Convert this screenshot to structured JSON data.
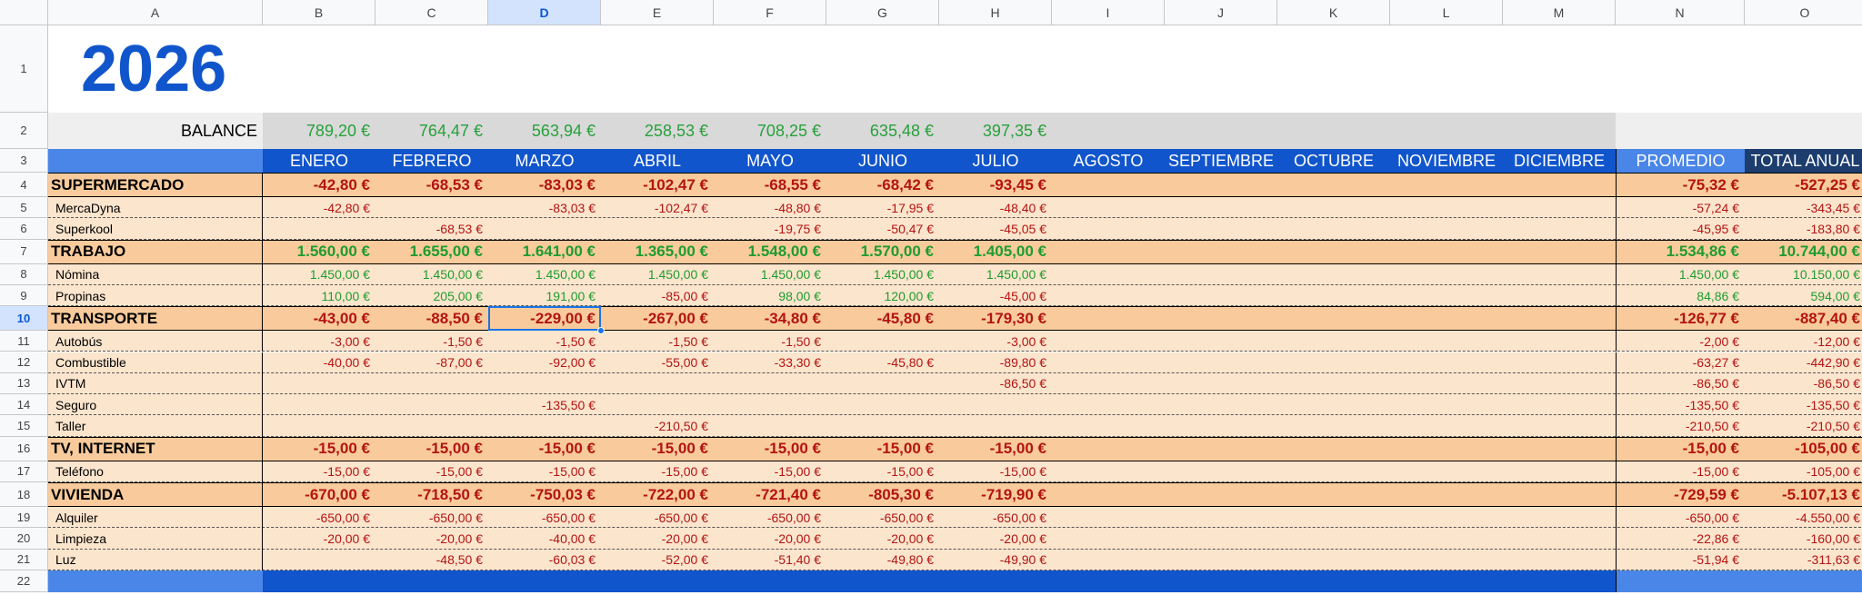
{
  "columns": [
    "A",
    "B",
    "C",
    "D",
    "E",
    "F",
    "G",
    "H",
    "I",
    "J",
    "K",
    "L",
    "M",
    "N",
    "O"
  ],
  "selected_column": "D",
  "selected_row": 10,
  "row_numbers": [
    1,
    2,
    3,
    4,
    5,
    6,
    7,
    8,
    9,
    10,
    11,
    12,
    13,
    14,
    15,
    16,
    17,
    18,
    19,
    20,
    21,
    22
  ],
  "title": "2026",
  "balance": {
    "label": "BALANCE",
    "values": [
      "789,20 €",
      "764,47 €",
      "563,94 €",
      "258,53 €",
      "708,25 €",
      "635,48 €",
      "397,35 €",
      "",
      "",
      "",
      "",
      "",
      "",
      ""
    ]
  },
  "months": [
    "ENERO",
    "FEBRERO",
    "MARZO",
    "ABRIL",
    "MAYO",
    "JUNIO",
    "JULIO",
    "AGOSTO",
    "SEPTIEMBRE",
    "OCTUBRE",
    "NOVIEMBRE",
    "DICIEMBRE",
    "PROMEDIO",
    "TOTAL ANUAL"
  ],
  "rows": [
    {
      "row": 4,
      "type": "category",
      "label": "SUPERMERCADO",
      "sign": "neg",
      "values": [
        "-42,80 €",
        "-68,53 €",
        "-83,03 €",
        "-102,47 €",
        "-68,55 €",
        "-68,42 €",
        "-93,45 €",
        "",
        "",
        "",
        "",
        "",
        "-75,32 €",
        "-527,25 €"
      ]
    },
    {
      "row": 5,
      "type": "item",
      "label": "MercaDyna",
      "sign": "neg",
      "values": [
        "-42,80 €",
        "",
        "-83,03 €",
        "-102,47 €",
        "-48,80 €",
        "-17,95 €",
        "-48,40 €",
        "",
        "",
        "",
        "",
        "",
        "-57,24 €",
        "-343,45 €"
      ]
    },
    {
      "row": 6,
      "type": "item",
      "label": "Superkool",
      "sign": "neg",
      "values": [
        "",
        "-68,53 €",
        "",
        "",
        "-19,75 €",
        "-50,47 €",
        "-45,05 €",
        "",
        "",
        "",
        "",
        "",
        "-45,95 €",
        "-183,80 €"
      ]
    },
    {
      "row": 7,
      "type": "category",
      "label": "TRABAJO",
      "sign": "pos",
      "values": [
        "1.560,00 €",
        "1.655,00 €",
        "1.641,00 €",
        "1.365,00 €",
        "1.548,00 €",
        "1.570,00 €",
        "1.405,00 €",
        "",
        "",
        "",
        "",
        "",
        "1.534,86 €",
        "10.744,00 €"
      ]
    },
    {
      "row": 8,
      "type": "item",
      "label": "Nómina",
      "sign": "pos",
      "values": [
        "1.450,00 €",
        "1.450,00 €",
        "1.450,00 €",
        "1.450,00 €",
        "1.450,00 €",
        "1.450,00 €",
        "1.450,00 €",
        "",
        "",
        "",
        "",
        "",
        "1.450,00 €",
        "10.150,00 €"
      ]
    },
    {
      "row": 9,
      "type": "item",
      "label": "Propinas",
      "sign": "mixed",
      "values": [
        "110,00 €",
        "205,00 €",
        "191,00 €",
        "-85,00 €",
        "98,00 €",
        "120,00 €",
        "-45,00 €",
        "",
        "",
        "",
        "",
        "",
        "84,86 €",
        "594,00 €"
      ]
    },
    {
      "row": 10,
      "type": "category",
      "label": "TRANSPORTE",
      "sign": "neg",
      "values": [
        "-43,00 €",
        "-88,50 €",
        "-229,00 €",
        "-267,00 €",
        "-34,80 €",
        "-45,80 €",
        "-179,30 €",
        "",
        "",
        "",
        "",
        "",
        "-126,77 €",
        "-887,40 €"
      ]
    },
    {
      "row": 11,
      "type": "item",
      "label": "Autobús",
      "sign": "neg",
      "values": [
        "-3,00 €",
        "-1,50 €",
        "-1,50 €",
        "-1,50 €",
        "-1,50 €",
        "",
        "-3,00 €",
        "",
        "",
        "",
        "",
        "",
        "-2,00 €",
        "-12,00 €"
      ]
    },
    {
      "row": 12,
      "type": "item",
      "label": "Combustible",
      "sign": "neg",
      "values": [
        "-40,00 €",
        "-87,00 €",
        "-92,00 €",
        "-55,00 €",
        "-33,30 €",
        "-45,80 €",
        "-89,80 €",
        "",
        "",
        "",
        "",
        "",
        "-63,27 €",
        "-442,90 €"
      ]
    },
    {
      "row": 13,
      "type": "item",
      "label": "IVTM",
      "sign": "neg",
      "values": [
        "",
        "",
        "",
        "",
        "",
        "",
        "-86,50 €",
        "",
        "",
        "",
        "",
        "",
        "-86,50 €",
        "-86,50 €"
      ]
    },
    {
      "row": 14,
      "type": "item",
      "label": "Seguro",
      "sign": "neg",
      "values": [
        "",
        "",
        "-135,50 €",
        "",
        "",
        "",
        "",
        "",
        "",
        "",
        "",
        "",
        "-135,50 €",
        "-135,50 €"
      ]
    },
    {
      "row": 15,
      "type": "item",
      "label": "Taller",
      "sign": "neg",
      "values": [
        "",
        "",
        "",
        "-210,50 €",
        "",
        "",
        "",
        "",
        "",
        "",
        "",
        "",
        "-210,50 €",
        "-210,50 €"
      ]
    },
    {
      "row": 16,
      "type": "category",
      "label": "TV, INTERNET",
      "sign": "neg",
      "values": [
        "-15,00 €",
        "-15,00 €",
        "-15,00 €",
        "-15,00 €",
        "-15,00 €",
        "-15,00 €",
        "-15,00 €",
        "",
        "",
        "",
        "",
        "",
        "-15,00 €",
        "-105,00 €"
      ]
    },
    {
      "row": 17,
      "type": "item",
      "label": "Teléfono",
      "sign": "neg",
      "values": [
        "-15,00 €",
        "-15,00 €",
        "-15,00 €",
        "-15,00 €",
        "-15,00 €",
        "-15,00 €",
        "-15,00 €",
        "",
        "",
        "",
        "",
        "",
        "-15,00 €",
        "-105,00 €"
      ]
    },
    {
      "row": 18,
      "type": "category",
      "label": "VIVIENDA",
      "sign": "neg",
      "values": [
        "-670,00 €",
        "-718,50 €",
        "-750,03 €",
        "-722,00 €",
        "-721,40 €",
        "-805,30 €",
        "-719,90 €",
        "",
        "",
        "",
        "",
        "",
        "-729,59 €",
        "-5.107,13 €"
      ]
    },
    {
      "row": 19,
      "type": "item",
      "label": "Alquiler",
      "sign": "neg",
      "values": [
        "-650,00 €",
        "-650,00 €",
        "-650,00 €",
        "-650,00 €",
        "-650,00 €",
        "-650,00 €",
        "-650,00 €",
        "",
        "",
        "",
        "",
        "",
        "-650,00 €",
        "-4.550,00 €"
      ]
    },
    {
      "row": 20,
      "type": "item",
      "label": "Limpieza",
      "sign": "neg",
      "values": [
        "-20,00 €",
        "-20,00 €",
        "-40,00 €",
        "-20,00 €",
        "-20,00 €",
        "-20,00 €",
        "-20,00 €",
        "",
        "",
        "",
        "",
        "",
        "-22,86 €",
        "-160,00 €"
      ]
    },
    {
      "row": 21,
      "type": "item",
      "label": "Luz",
      "sign": "neg",
      "values": [
        "",
        "-48,50 €",
        "-60,03 €",
        "-52,00 €",
        "-51,40 €",
        "-49,80 €",
        "-49,90 €",
        "",
        "",
        "",
        "",
        "",
        "-51,94 €",
        "-311,63 €"
      ]
    }
  ],
  "colors": {
    "positive": "#1e9c2e",
    "negative": "#b31412",
    "header_blue": "#1155cc",
    "header_light_blue": "#4a86e8",
    "total_header_dark": "#1c3d6e",
    "category_bg": "#f9cb9c",
    "item_bg": "#fce5cd",
    "balance_bg": "#d9d9d9",
    "balance_label_bg": "#efefef"
  }
}
